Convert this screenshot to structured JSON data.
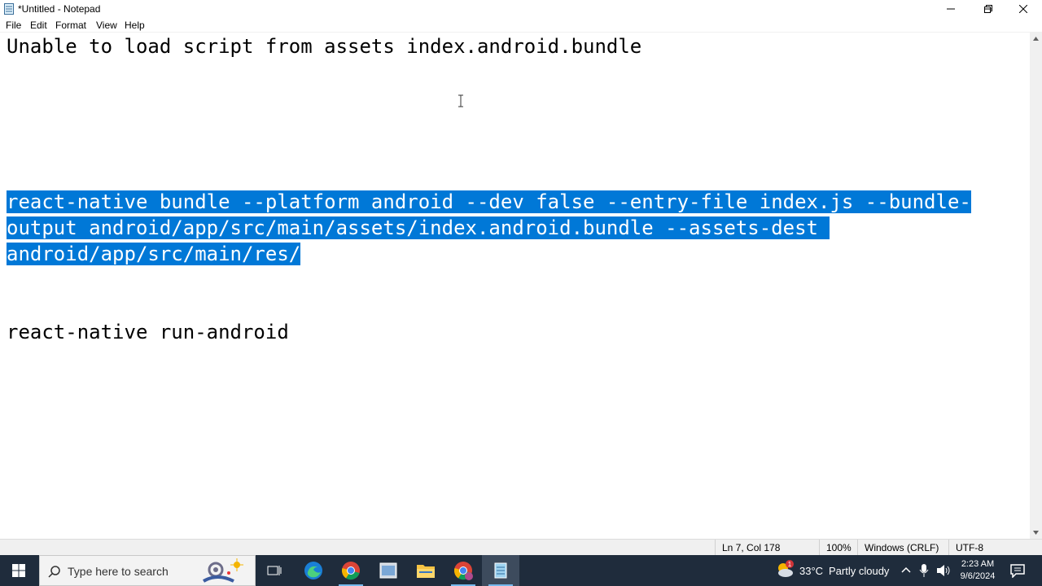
{
  "window": {
    "title": "*Untitled - Notepad",
    "controls": {
      "minimize": "minimize",
      "restore": "restore",
      "close": "close"
    }
  },
  "menu": [
    "File",
    "Edit",
    "Format",
    "View",
    "Help"
  ],
  "editor": {
    "lines": [
      {
        "text": "Unable to load script from assets index.android.bundle",
        "selected": false
      },
      {
        "text": "react-native bundle --platform android --dev false --entry-file index.js --bundle-",
        "selected": true
      },
      {
        "text": "output android/app/src/main/assets/index.android.bundle --assets-dest ",
        "selected": true
      },
      {
        "text": "android/app/src/main/res/",
        "selected": true
      },
      {
        "text": "react-native run-android",
        "selected": false
      }
    ],
    "selection_color": "#0078d7"
  },
  "status": {
    "position": "Ln 7, Col 178",
    "zoom": "100%",
    "line_ending": "Windows (CRLF)",
    "encoding": "UTF-8"
  },
  "taskbar": {
    "search_placeholder": "Type here to search",
    "weather_temp": "33°C",
    "weather_text": "Partly cloudy",
    "time": "2:23 AM",
    "date": "9/6/2024",
    "chrome_badge": "1"
  }
}
